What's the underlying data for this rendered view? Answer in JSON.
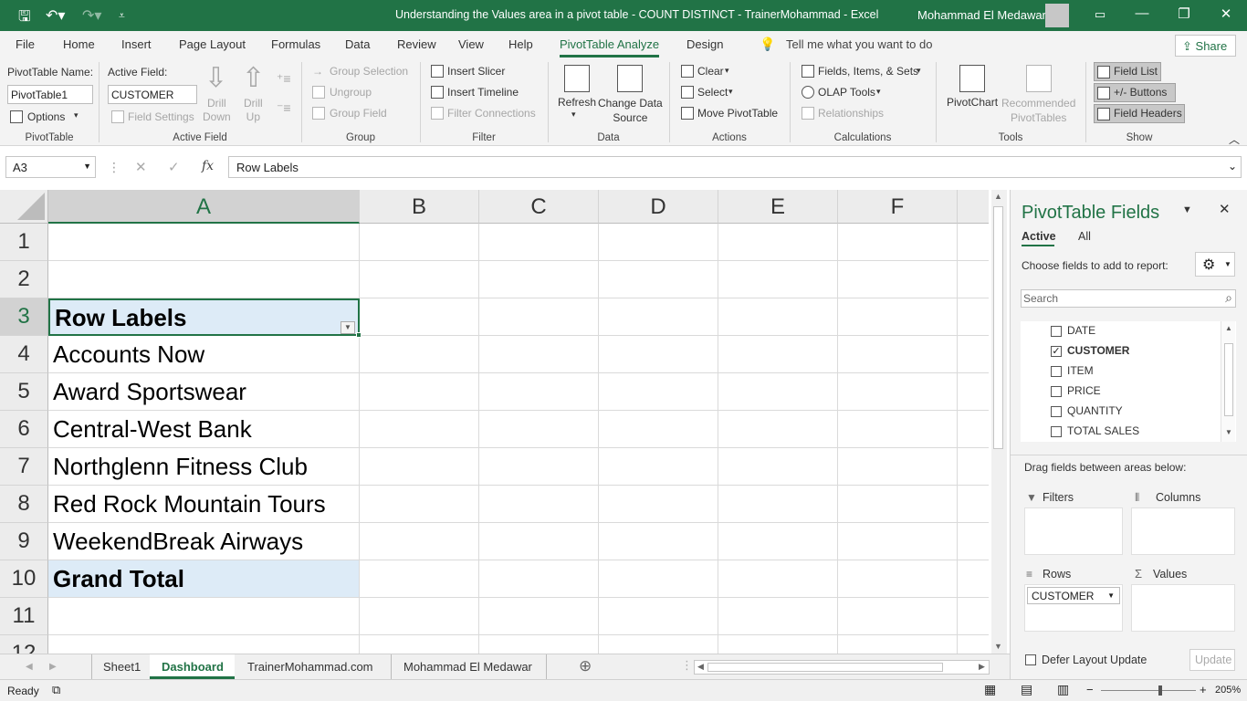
{
  "title_bar": {
    "title": "Understanding the Values area in a pivot table - COUNT DISTINCT - TrainerMohammad  -  Excel",
    "user": "Mohammad El Medawar"
  },
  "tabs": [
    "File",
    "Home",
    "Insert",
    "Page Layout",
    "Formulas",
    "Data",
    "Review",
    "View",
    "Help",
    "PivotTable Analyze",
    "Design"
  ],
  "active_tab": "PivotTable Analyze",
  "tell_me": "Tell me what you want to do",
  "share": "Share",
  "ribbon": {
    "pivottable": {
      "name_label": "PivotTable Name:",
      "name_value": "PivotTable1",
      "options": "Options",
      "group": "PivotTable"
    },
    "active_field": {
      "label": "Active Field:",
      "value": "CUSTOMER",
      "field_settings": "Field Settings",
      "drill_down": "Drill\nDown",
      "drill_up": "Drill\nUp",
      "group": "Active Field"
    },
    "group": {
      "group_selection": "Group Selection",
      "ungroup": "Ungroup",
      "group_field": "Group Field",
      "group": "Group"
    },
    "filter": {
      "insert_slicer": "Insert Slicer",
      "insert_timeline": "Insert Timeline",
      "filter_connections": "Filter Connections",
      "group": "Filter"
    },
    "data": {
      "refresh": "Refresh",
      "change_data_source": "Change Data\nSource",
      "group": "Data"
    },
    "actions": {
      "clear": "Clear",
      "select": "Select",
      "move": "Move PivotTable",
      "group": "Actions"
    },
    "calculations": {
      "fields_items_sets": "Fields, Items, & Sets",
      "olap_tools": "OLAP Tools",
      "relationships": "Relationships",
      "group": "Calculations"
    },
    "tools": {
      "pivotchart": "PivotChart",
      "recommended": "Recommended\nPivotTables",
      "group": "Tools"
    },
    "show": {
      "field_list": "Field List",
      "buttons": "+/- Buttons",
      "field_headers": "Field Headers",
      "group": "Show"
    }
  },
  "formula_bar": {
    "name_box": "A3",
    "fx": "fx",
    "content": "Row Labels"
  },
  "grid": {
    "columns": [
      "A",
      "B",
      "C",
      "D",
      "E",
      "F"
    ],
    "rows": [
      "1",
      "2",
      "3",
      "4",
      "5",
      "6",
      "7",
      "8",
      "9",
      "10",
      "11",
      "12"
    ],
    "cells_a": [
      "",
      "",
      "Row Labels",
      "Accounts Now",
      "Award Sportswear",
      "Central-West Bank",
      "Northglenn Fitness Club",
      "Red Rock Mountain Tours",
      "WeekendBreak Airways",
      "Grand Total",
      "",
      ""
    ]
  },
  "sheets": [
    "Sheet1",
    "Dashboard",
    "TrainerMohammad.com",
    "Mohammad El Medawar"
  ],
  "active_sheet": "Dashboard",
  "status": {
    "ready": "Ready",
    "zoom": "205%"
  },
  "pane": {
    "title": "PivotTable Fields",
    "tab_active": "Active",
    "tab_all": "All",
    "choose": "Choose fields to add to report:",
    "search_placeholder": "Search",
    "fields": [
      {
        "name": "DATE",
        "checked": false
      },
      {
        "name": "CUSTOMER",
        "checked": true
      },
      {
        "name": "ITEM",
        "checked": false
      },
      {
        "name": "PRICE",
        "checked": false
      },
      {
        "name": "QUANTITY",
        "checked": false
      },
      {
        "name": "TOTAL SALES",
        "checked": false
      }
    ],
    "drag": "Drag fields between areas below:",
    "filters": "Filters",
    "columns": "Columns",
    "rows": "Rows",
    "values": "Values",
    "rows_item": "CUSTOMER",
    "defer": "Defer Layout Update",
    "update": "Update"
  },
  "colors": {
    "excel_green": "#217346",
    "pivot_header": "#ddebf7"
  }
}
